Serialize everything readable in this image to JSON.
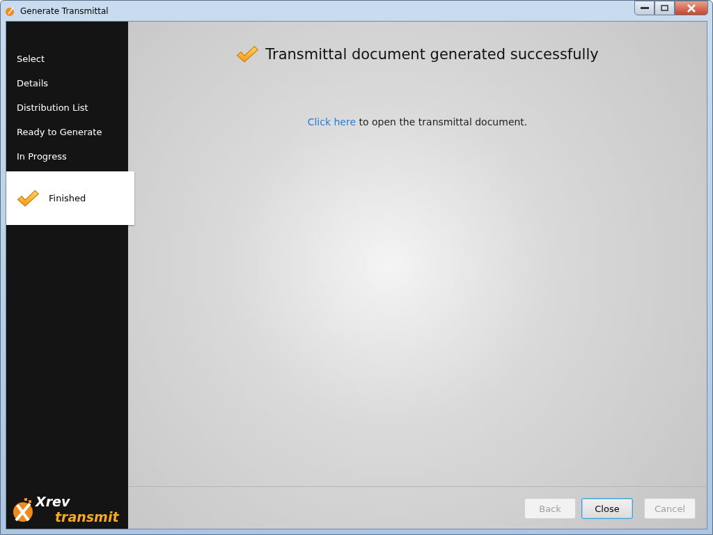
{
  "window": {
    "title": "Generate Transmittal"
  },
  "steps": [
    {
      "label": "Select",
      "selected": false
    },
    {
      "label": "Details",
      "selected": false
    },
    {
      "label": "Distribution List",
      "selected": false
    },
    {
      "label": "Ready to Generate",
      "selected": false
    },
    {
      "label": "In Progress",
      "selected": false
    },
    {
      "label": "Finished",
      "selected": true
    }
  ],
  "logo": {
    "brand": "Xrev",
    "product": "transmit"
  },
  "heading": "Transmittal document generated successfully",
  "message": {
    "link": "Click here",
    "text": " to open the transmittal document."
  },
  "buttons": [
    {
      "label": "Back",
      "disabled": true,
      "default": false
    },
    {
      "label": "Close",
      "disabled": false,
      "default": true
    },
    {
      "label": "Cancel",
      "disabled": true,
      "default": false
    }
  ]
}
